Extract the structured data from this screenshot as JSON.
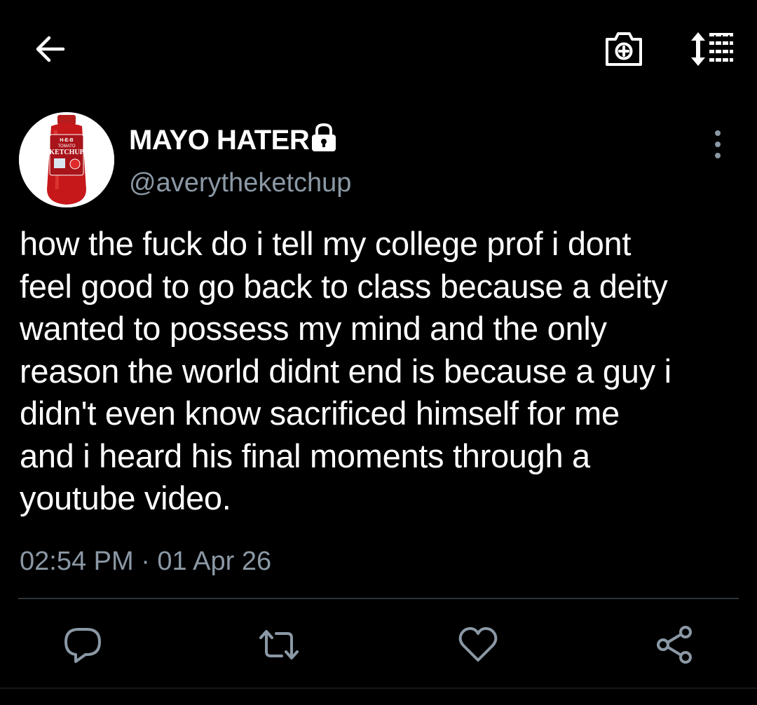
{
  "icons": {
    "back": "arrow-left-icon",
    "camera": "camera-plus-icon",
    "sort": "sort-list-icon",
    "lock": "lock-icon",
    "more": "more-vertical-icon",
    "reply": "reply-icon",
    "retweet": "retweet-icon",
    "like": "heart-icon",
    "share": "share-icon"
  },
  "colors": {
    "background": "#000000",
    "text": "#ffffff",
    "secondary_text": "#8b98a5",
    "divider": "#2f3336"
  },
  "avatar": {
    "label_top": "H-E-B",
    "label_mid": "TOMATO",
    "label_main": "KETCHUP"
  },
  "tweet": {
    "display_name": "MAYO HATER",
    "handle": "@averytheketchup",
    "text": "how the fuck do i tell my college prof i dont\nfeel good to go back to class because a deity\nwanted to possess my mind and the only\nreason the world didnt end is because a guy i\ndidn't even know sacrificed himself for me\nand i heard his final moments through a\nyoutube video.",
    "timestamp": "02:54 PM · 01 Apr 26"
  }
}
